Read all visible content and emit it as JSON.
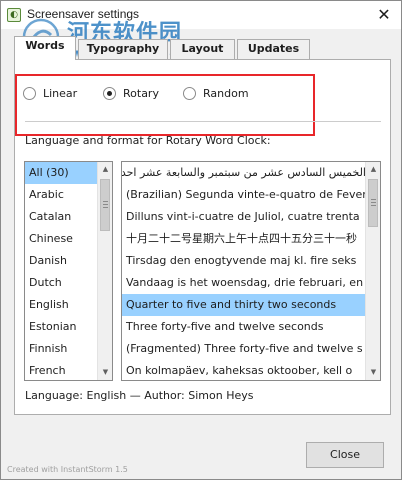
{
  "window": {
    "title": "Screensaver settings",
    "close_glyph": "✕",
    "icon": "screensaver-app-icon"
  },
  "watermark": {
    "line1": "河东软件园",
    "line2": "www.pc0359.cn"
  },
  "tabs": [
    {
      "label": "Words",
      "active": true
    },
    {
      "label": "Typography",
      "active": false
    },
    {
      "label": "Layout",
      "active": false
    },
    {
      "label": "Updates",
      "active": false
    }
  ],
  "algorithm": {
    "options": [
      {
        "label": "Linear",
        "checked": false
      },
      {
        "label": "Rotary",
        "checked": true
      },
      {
        "label": "Random",
        "checked": false
      }
    ]
  },
  "section_label": "Language and format for Rotary Word Clock:",
  "languages": [
    {
      "label": "All (30)",
      "selected": true
    },
    {
      "label": "Arabic",
      "selected": false
    },
    {
      "label": "Catalan",
      "selected": false
    },
    {
      "label": "Chinese",
      "selected": false
    },
    {
      "label": "Danish",
      "selected": false
    },
    {
      "label": "Dutch",
      "selected": false
    },
    {
      "label": "English",
      "selected": false
    },
    {
      "label": "Estonian",
      "selected": false
    },
    {
      "label": "Finnish",
      "selected": false
    },
    {
      "label": "French",
      "selected": false
    }
  ],
  "formats": [
    {
      "label": "الخميس السادس عشر من سبتمبر والسابعة عشر احدى و دقيقة ومساءً و ثد",
      "selected": false
    },
    {
      "label": "(Brazilian) Segunda vinte-e-quatro de Fevereiro",
      "selected": false
    },
    {
      "label": "Dilluns vint-i-cuatre de Juliol, cuatre trenta",
      "selected": false
    },
    {
      "label": "十月二十二号星期六上午十点四十五分三十一秒",
      "selected": false
    },
    {
      "label": "Tirsdag den enogtyvende maj kl. fire seks",
      "selected": false
    },
    {
      "label": "Vandaag is het woensdag, drie februari, en",
      "selected": false
    },
    {
      "label": "Quarter to five and thirty two seconds",
      "selected": true
    },
    {
      "label": "Three forty-five and twelve seconds",
      "selected": false
    },
    {
      "label": "(Fragmented) Three forty-five and twelve s",
      "selected": false
    },
    {
      "label": "On kolmapäev, kaheksas oktoober, kell o",
      "selected": false
    }
  ],
  "footer_info": "Language: English — Author: Simon Heys",
  "created_with": "Created with InstantStorm 1.5",
  "close_button": "Close",
  "scroll_up_glyph": "▲",
  "scroll_down_glyph": "▼",
  "colors": {
    "selection": "#99d1ff",
    "highlight_border": "#e8262a",
    "watermark": "#2f7fc1"
  }
}
